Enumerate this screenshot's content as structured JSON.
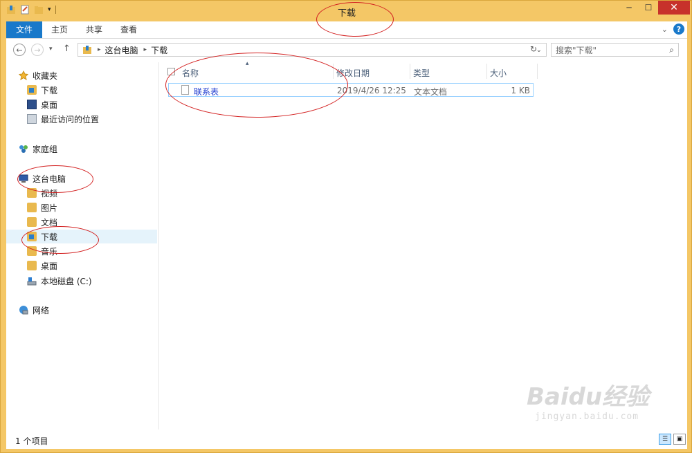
{
  "window": {
    "title": "下载"
  },
  "ribbon": {
    "tabs": [
      {
        "label": "文件"
      },
      {
        "label": "主页"
      },
      {
        "label": "共享"
      },
      {
        "label": "查看"
      }
    ]
  },
  "address": {
    "crumbs": [
      "这台电脑",
      "下载"
    ],
    "search_placeholder": "搜索\"下载\""
  },
  "sidebar": {
    "favorites": {
      "label": "收藏夹",
      "items": [
        {
          "label": "下载"
        },
        {
          "label": "桌面"
        },
        {
          "label": "最近访问的位置"
        }
      ]
    },
    "homegroup": {
      "label": "家庭组"
    },
    "this_pc": {
      "label": "这台电脑",
      "items": [
        {
          "label": "视频"
        },
        {
          "label": "图片"
        },
        {
          "label": "文档"
        },
        {
          "label": "下载"
        },
        {
          "label": "音乐"
        },
        {
          "label": "桌面"
        },
        {
          "label": "本地磁盘 (C:)"
        }
      ]
    },
    "network": {
      "label": "网络"
    }
  },
  "columns": [
    "名称",
    "修改日期",
    "类型",
    "大小"
  ],
  "files": [
    {
      "name": "联系表",
      "modified": "2019/4/26 12:25",
      "type": "文本文档",
      "size": "1 KB"
    }
  ],
  "status": {
    "count": "1 个项目"
  },
  "watermark": {
    "brand": "Baidu经验",
    "url": "jingyan.baidu.com"
  }
}
